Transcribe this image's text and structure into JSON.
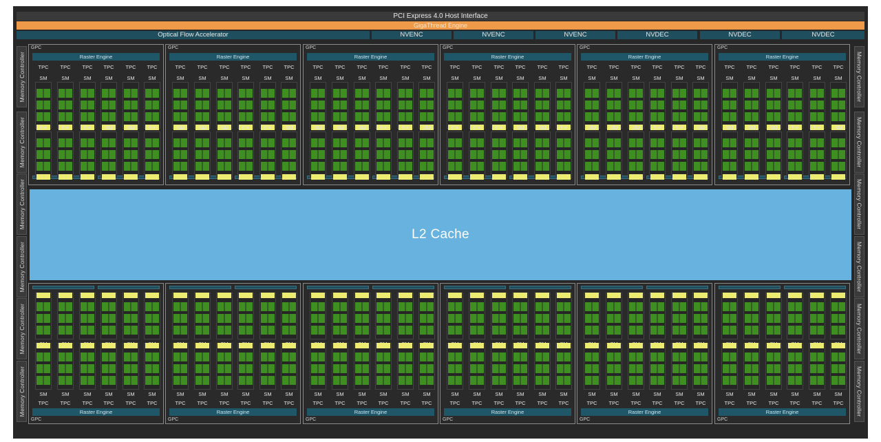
{
  "header": {
    "pcie": "PCI Express 4.0 Host Interface",
    "gigathread": "GigaThread Engine",
    "optical_flow": "Optical Flow Accelerator",
    "engines": [
      "NVENC",
      "NVENC",
      "NVENC",
      "NVDEC",
      "NVDEC",
      "NVDEC"
    ]
  },
  "memory_controller_label": "Memory Controller",
  "l2_cache": "L2 Cache",
  "gpc": {
    "label": "GPC",
    "raster_engine": "Raster Engine",
    "tpc_label": "TPC",
    "sm_label": "SM",
    "top_row_count": 6,
    "bottom_row_count": 6,
    "tpcs_per_gpc": 6
  },
  "colors": {
    "background": "#272727",
    "gigathread": "#ef9a48",
    "l2_cache": "#67b2df",
    "raster_engine": "#1f5668",
    "cuda_cores": "#3e8e22",
    "rt_core": "#ecec72"
  }
}
